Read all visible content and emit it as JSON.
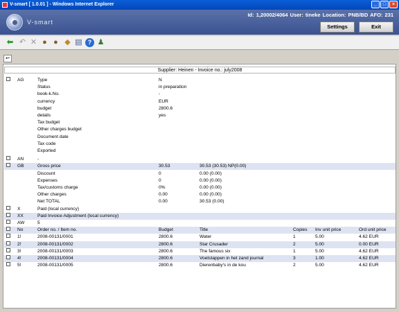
{
  "window": {
    "title": "V-smart [ 1.0.01 ] - Windows Internet Explorer"
  },
  "header": {
    "logo_text": "V-smart",
    "userinfo": "Id: 1,20002/4064  User: tineke  Location: PNB/BD  AFO: 231",
    "settings_label": "Settings",
    "exit_label": "Exit"
  },
  "toolbar": {
    "icons": [
      "back-arrow-icon",
      "undo-icon",
      "delete-icon",
      "person-icon",
      "person-edit-icon",
      "person-list-icon",
      "invoice-icon",
      "help-icon",
      "users-icon"
    ]
  },
  "panel": {
    "title": "Supplier: Heinen - Invoice no.: july2008",
    "ag": {
      "code": "AG",
      "rows": [
        {
          "label": "Type",
          "value": "N"
        },
        {
          "label": "Status",
          "value": "in preparation"
        },
        {
          "label": "book-k.No.",
          "value": "-"
        },
        {
          "label": "currency",
          "value": "EUR"
        },
        {
          "label": "budget",
          "value": "2800.6"
        },
        {
          "label": "details",
          "value": "yes"
        },
        {
          "label": "Tax budget",
          "value": ""
        },
        {
          "label": "Other charges budget",
          "value": ""
        },
        {
          "label": "Document date",
          "value": ""
        },
        {
          "label": "Tax code",
          "value": ""
        },
        {
          "label": "Exported",
          "value": ""
        }
      ]
    },
    "an": {
      "code": "AN",
      "value": "-"
    },
    "gb": {
      "code": "GB",
      "rows": [
        {
          "label": "Gross price",
          "v1": "30.53",
          "v2": "30.53 (30.53) NP(0.00)"
        },
        {
          "label": "Discount",
          "v1": "0",
          "v2": "0.00 (0.00)"
        },
        {
          "label": "Expenses",
          "v1": "0",
          "v2": "0.00 (0.00)"
        },
        {
          "label": "Tax/customs charge",
          "v1": "0%",
          "v2": "0.00 (0.00)"
        },
        {
          "label": "Other charges",
          "v1": "0.00",
          "v2": "0.00 (0.00)"
        },
        {
          "label": "Net TOTAL",
          "v1": "0.00",
          "v2": "30.53 (0.00)"
        }
      ]
    },
    "x": {
      "code": "X",
      "label": "Paid (local currency)"
    },
    "xx": {
      "code": "XX",
      "label": "Paid Invoice Adjustment (local currency)"
    },
    "aw": {
      "code": "AW",
      "value": "5"
    },
    "items_header": {
      "no": "No",
      "order": "Order no. / Item no.",
      "budget": "Budget",
      "title": "Title",
      "copies": "Copies",
      "inv": "Inv unit price",
      "ord": "Ord unit price"
    },
    "items": [
      {
        "no": "1!",
        "order": "2008-00131/0001",
        "budget": "2800.6",
        "title": "Water",
        "copies": "1",
        "inv": "5.00",
        "ord": "4.62 EUR"
      },
      {
        "no": "2!",
        "order": "2008-00131/0002",
        "budget": "2800.6",
        "title": "Star Crusader",
        "copies": "2",
        "inv": "5.00",
        "ord": "0.00 EUR"
      },
      {
        "no": "3!",
        "order": "2008-00131/0003",
        "budget": "2800.6",
        "title": "The famous six",
        "copies": "1",
        "inv": "5.00",
        "ord": "4.62 EUR"
      },
      {
        "no": "4!",
        "order": "2008-00131/0004",
        "budget": "2800.6",
        "title": "Voetstappen in het zand journal",
        "copies": "3",
        "inv": "1.00",
        "ord": "4.62 EUR"
      },
      {
        "no": "5!",
        "order": "2008-00131/0005",
        "budget": "2800.6",
        "title": "Dierenbaby's in de kou",
        "copies": "2",
        "inv": "5.00",
        "ord": "4.62 EUR"
      }
    ]
  }
}
